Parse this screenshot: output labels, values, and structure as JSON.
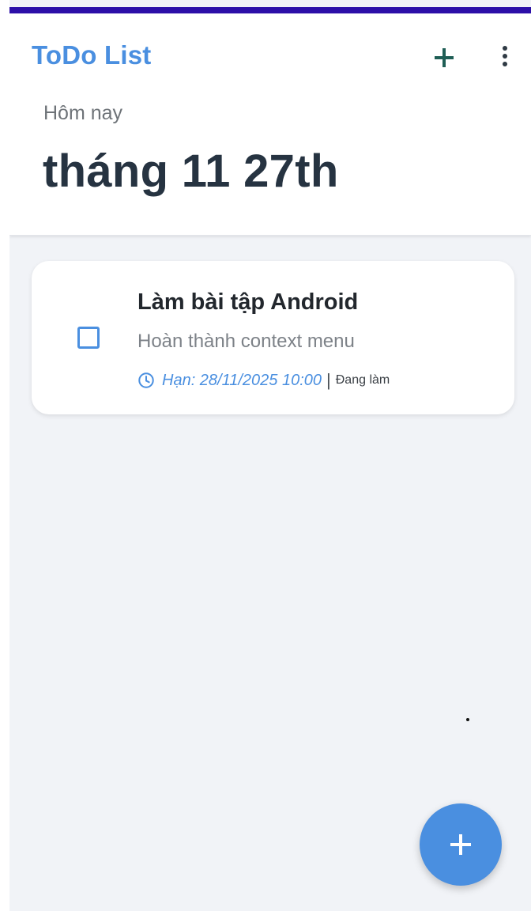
{
  "app": {
    "title": "ToDo List"
  },
  "toolbar": {
    "add_icon": "plus-icon",
    "menu_icon": "more-vert-icon"
  },
  "header": {
    "subtitle": "Hôm nay",
    "date": "tháng 11 27th"
  },
  "tasks": [
    {
      "title": "Làm bài tập Android",
      "description": "Hoàn thành context menu",
      "due": "Hạn: 28/11/2025 10:00",
      "separator": "|",
      "status": "Đang làm",
      "checked": false
    }
  ],
  "fab": {
    "icon": "plus-icon"
  },
  "colors": {
    "accent": "#4a8fe0",
    "status_bar": "#2c0fa8",
    "heading": "#263341",
    "background": "#f1f3f7"
  }
}
